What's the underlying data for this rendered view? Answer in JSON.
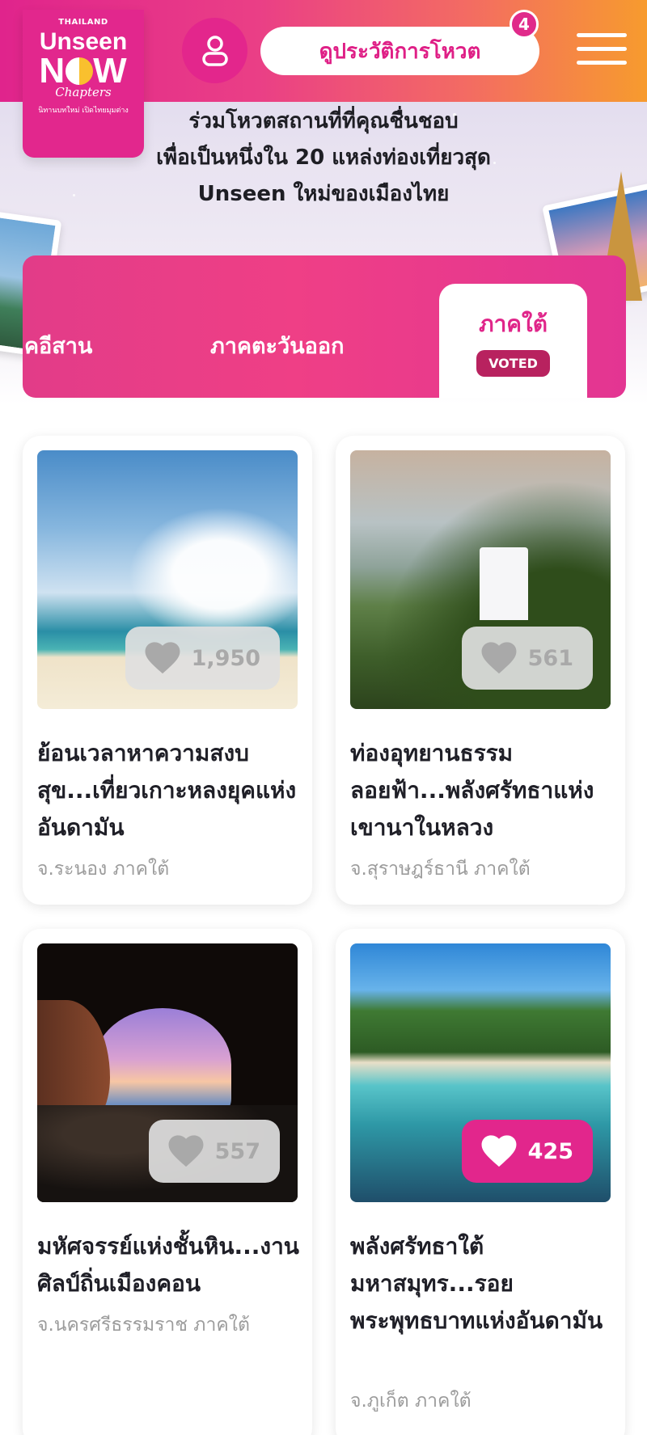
{
  "header": {
    "logo": {
      "top": "THAILAND",
      "line1": "Unseen",
      "line2": "NEW",
      "script": "Chapters",
      "tagline": "นิทานบทใหม่ เปิดไทยมุมต่าง"
    },
    "history_button_label": "ดูประวัติการโหวต",
    "history_badge_count": "4"
  },
  "hero": {
    "line1": "ร่วมโหวตสถานที่ที่คุณชื่นชอบ",
    "line2": "เพื่อเป็นหนึ่งใน 20 แหล่งท่องเที่ยวสุด",
    "line3": "Unseen ใหม่ของเมืองไทย"
  },
  "tabs": {
    "items": [
      {
        "label": "คอีสาน",
        "active": false
      },
      {
        "label": "ภาคตะวันออก",
        "active": false
      },
      {
        "label": "ภาคใต้",
        "active": true,
        "badge": "VOTED"
      }
    ]
  },
  "cards": [
    {
      "likes": "1,950",
      "liked": false,
      "title": "ย้อนเวลาหาความสงบสุข...เที่ยวเกาะหลงยุคแห่งอันดามัน",
      "location": "จ.ระนอง ภาคใต้"
    },
    {
      "likes": "561",
      "liked": false,
      "title": "ท่องอุทยานธรรมลอยฟ้า...พลังศรัทธาแห่งเขานาในหลวง",
      "location": "จ.สุราษฎร์ธานี ภาคใต้"
    },
    {
      "likes": "557",
      "liked": false,
      "title": "มหัศจรรย์แห่งชั้นหิน...งานศิลป์ถิ่นเมืองคอน",
      "location": "จ.นครศรีธรรมราช ภาคใต้"
    },
    {
      "likes": "425",
      "liked": true,
      "title": "พลังศรัทธาใต้มหาสมุทร...รอยพระพุทธบาทแห่งอันดามัน",
      "location": "จ.ภูเก็ต ภาคใต้"
    }
  ],
  "colors": {
    "brand_pink": "#e2268c",
    "accent_orange": "#f79b2e",
    "voted_badge": "#b8225f"
  }
}
